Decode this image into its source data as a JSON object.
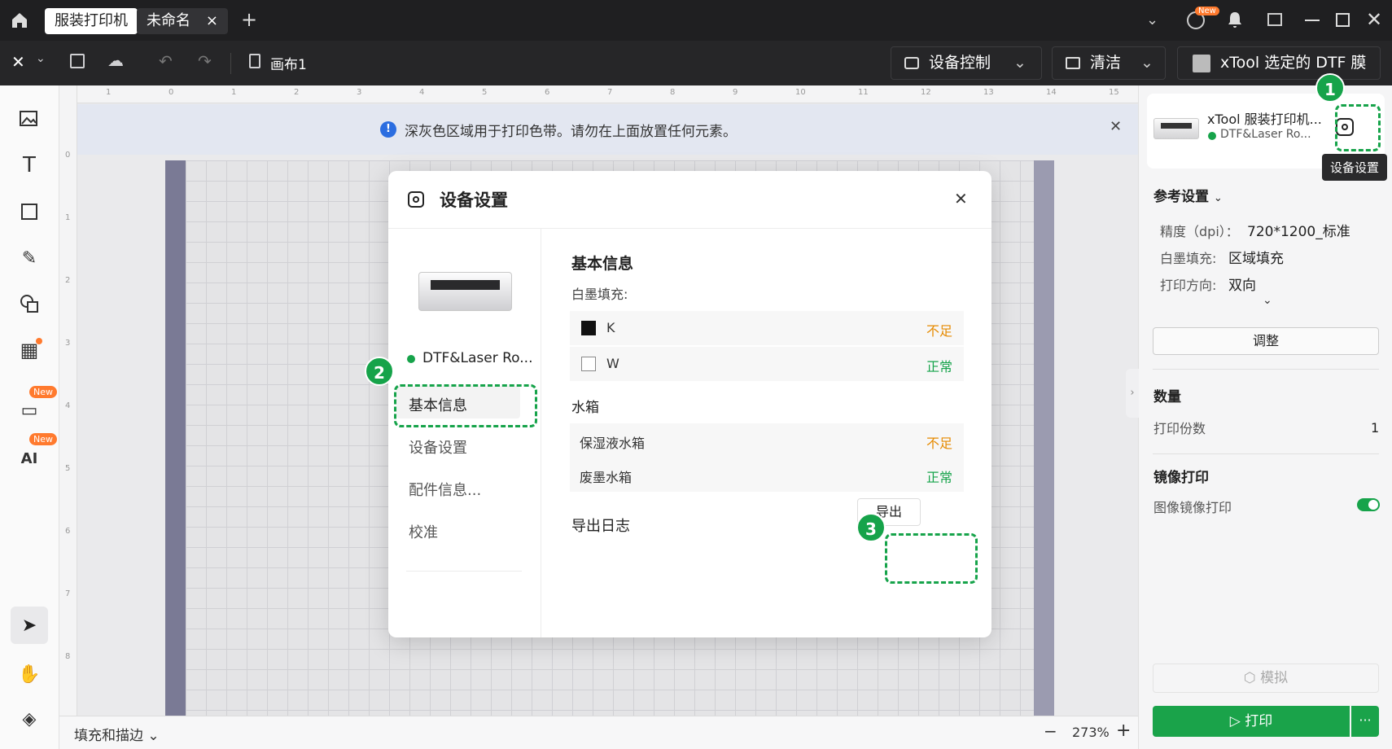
{
  "titlebar": {
    "tab_app": "服装打印机",
    "tab_doc": "未命名",
    "close": "×",
    "add": "+",
    "new_badge": "New"
  },
  "toolbar": {
    "canvas_name": "画布1",
    "device_control": "设备控制",
    "clean": "清洁",
    "material": "xTool 选定的 DTF 膜"
  },
  "ruler": {
    "top": [
      "1",
      "0",
      "1",
      "2",
      "3",
      "4",
      "5",
      "6",
      "7",
      "8",
      "9",
      "10",
      "11",
      "12",
      "13",
      "14",
      "15",
      "16"
    ],
    "left": [
      "0",
      "1",
      "2",
      "3",
      "4",
      "5",
      "6",
      "7",
      "8"
    ]
  },
  "notice": {
    "text": "深灰色区域用于打印色带。请勿在上面放置任何元素。"
  },
  "left_tools": {
    "new1": "New",
    "new2": "New"
  },
  "device_card": {
    "name": "xTool 服装打印机...",
    "status": "DTF&Laser Ro...",
    "tooltip": "设备设置"
  },
  "reference": {
    "title": "参考设置",
    "precision_label": "精度（dpi）：",
    "precision_value": "720*1200_标准",
    "white_fill_label": "白墨填充:",
    "white_fill_value": "区域填充",
    "direction_label": "打印方向:",
    "direction_value": "双向",
    "adjust": "调整"
  },
  "quantity": {
    "title": "数量",
    "copies_label": "打印份数",
    "copies_value": "1"
  },
  "mirror": {
    "title": "镜像打印",
    "label": "图像镜像打印",
    "enabled": true
  },
  "actions": {
    "simulate": "模拟",
    "print": "打印",
    "more": "···"
  },
  "bottom": {
    "fill_stroke": "填充和描边",
    "zoom": "273%",
    "minus": "−",
    "plus": "+"
  },
  "dialog": {
    "title": "设备设置",
    "device_status": "DTF&Laser Ro...",
    "menu": [
      "基本信息",
      "设备设置",
      "配件信息...",
      "校准"
    ],
    "basic_info_title": "基本信息",
    "white_ink_label": "白墨填充:",
    "inks": [
      {
        "name": "K",
        "status": "不足",
        "color": "#111111"
      },
      {
        "name": "W",
        "status": "正常",
        "color": "#ffffff"
      }
    ],
    "tank_title": "水箱",
    "tanks": [
      {
        "name": "保湿液水箱",
        "status": "不足"
      },
      {
        "name": "废墨水箱",
        "status": "正常"
      }
    ],
    "export_title": "导出日志",
    "export_button": "导出"
  },
  "callouts": [
    "1",
    "2",
    "3"
  ],
  "colors": {
    "accent": "#16a34a",
    "warning": "#e68a00",
    "dark": "#1f1f21",
    "stripe": "#7a7a95"
  }
}
